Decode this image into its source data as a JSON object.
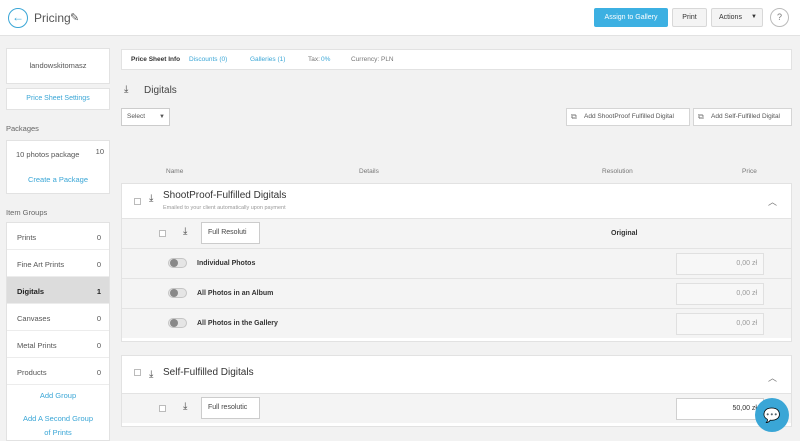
{
  "header": {
    "back_icon": "arrow-left-icon",
    "title": "Pricing",
    "edit_icon": "pencil-icon",
    "assign_label": "Assign to Gallery",
    "print_label": "Print",
    "actions_label": "Actions",
    "help_label": "?"
  },
  "sidebar": {
    "account": "landowskitomasz",
    "price_sheet_settings": "Price Sheet Settings",
    "packages_heading": "Packages",
    "package": {
      "name": "10 photos package",
      "count": "10"
    },
    "create_package": "Create a Package",
    "item_groups_heading": "Item Groups",
    "groups": [
      {
        "label": "Prints",
        "count": "0"
      },
      {
        "label": "Fine Art Prints",
        "count": "0"
      },
      {
        "label": "Digitals",
        "count": "1"
      },
      {
        "label": "Canvases",
        "count": "0"
      },
      {
        "label": "Metal Prints",
        "count": "0"
      },
      {
        "label": "Products",
        "count": "0"
      }
    ],
    "add_group": "Add Group",
    "add_second_group_line1": "Add A Second Group",
    "add_second_group_line2": "of Prints"
  },
  "infobar": {
    "price_sheet_info": "Price Sheet Info",
    "discounts": "Discounts (0)",
    "galleries": "Galleries (1)",
    "tax_label": "Tax:",
    "tax_value": "0%",
    "currency": "Currency: PLN"
  },
  "section": {
    "title": "Digitals",
    "select_label": "Select",
    "add_shootproof": "Add ShootProof Fulfilled Digital",
    "add_self": "Add Self-Fulfilled Digital"
  },
  "columns": {
    "name": "Name",
    "details": "Details",
    "resolution": "Resolution",
    "price": "Price"
  },
  "shootproof_panel": {
    "title": "ShootProof-Fulfilled Digitals",
    "subtitle": "Emailed to your client automatically upon payment",
    "resolution_value": "Full Resoluti",
    "resolution_label": "Original",
    "options": [
      {
        "label": "Individual Photos",
        "price": "0,00 zł"
      },
      {
        "label": "All Photos in an Album",
        "price": "0,00 zł"
      },
      {
        "label": "All Photos in the Gallery",
        "price": "0,00 zł"
      }
    ]
  },
  "self_panel": {
    "title": "Self-Fulfilled Digitals",
    "resolution_value": "Full resolutic",
    "price": "50,00 zł"
  },
  "chat_icon": "chat-bubble-icon"
}
